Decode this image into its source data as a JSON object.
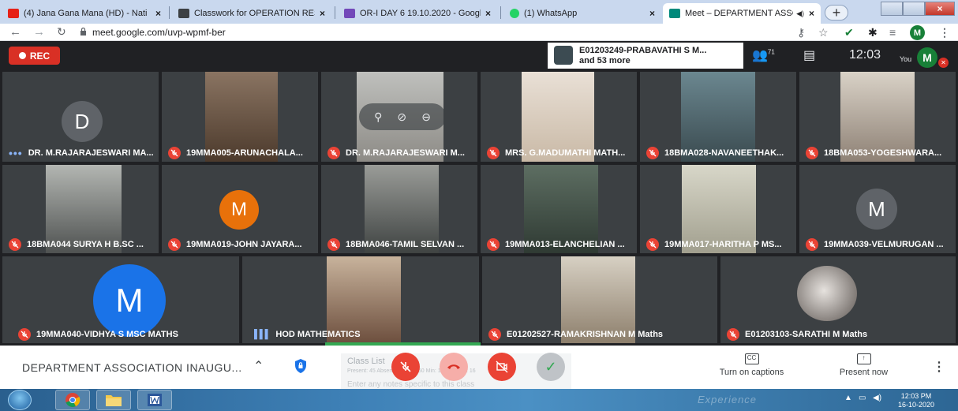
{
  "browser": {
    "tabs": [
      {
        "title": "(4) Jana Gana Mana (HD) - Nati",
        "favicon_color": "#e62117",
        "icon": "youtube-icon"
      },
      {
        "title": "Classwork for OPERATION RESE",
        "favicon_color": "#3c4043",
        "icon": "classroom-icon"
      },
      {
        "title": "OR-I DAY 6 19.10.2020 - Googl",
        "favicon_color": "#7248b9",
        "icon": "forms-icon"
      },
      {
        "title": "(1) WhatsApp",
        "favicon_color": "#25d366",
        "icon": "whatsapp-icon"
      },
      {
        "title": "Meet – DEPARTMENT ASSC",
        "favicon_color": "#00897b",
        "icon": "meet-icon",
        "active": true
      }
    ],
    "new_tab": "+",
    "close_glyph": "×",
    "url": "meet.google.com/uvp-wpmf-ber",
    "profile_initial": "M"
  },
  "meet_top": {
    "rec_label": "REC",
    "presenter_line1": "E01203249-PRABAVATHI S M...",
    "presenter_line2": "and 53 more",
    "participants_count": "71",
    "time": "12:03",
    "you_label": "You",
    "you_initial": "M"
  },
  "participants": [
    {
      "name": "DR. M.RAJARAJESWARI MA...",
      "type": "avatar",
      "initial": "D",
      "avatar_color": "#5f6368",
      "mic": "dots"
    },
    {
      "name": "19MMA005-ARUNACHALA...",
      "type": "video",
      "mic": "off"
    },
    {
      "name": "DR. M.RAJARAJESWARI M...",
      "type": "video",
      "mic": "off"
    },
    {
      "name": "MRS. G.MADUMATHI MATH...",
      "type": "video",
      "mic": "off"
    },
    {
      "name": "18BMA028-NAVANEETHAK...",
      "type": "video",
      "mic": "off"
    },
    {
      "name": "18BMA053-YOGESHWARA...",
      "type": "video",
      "mic": "off"
    },
    {
      "name": "18BMA044 SURYA H B.SC ...",
      "type": "video",
      "mic": "off"
    },
    {
      "name": "19MMA019-JOHN JAYARA...",
      "type": "avatar",
      "initial": "M",
      "avatar_color": "#e8710a",
      "mic": "off"
    },
    {
      "name": "18BMA046-TAMIL SELVAN ...",
      "type": "video",
      "mic": "off"
    },
    {
      "name": "19MMA013-ELANCHELIAN ...",
      "type": "video",
      "mic": "off"
    },
    {
      "name": "19MMA017-HARITHA P MS...",
      "type": "video",
      "mic": "off"
    },
    {
      "name": "19MMA039-VELMURUGAN ...",
      "type": "avatar",
      "initial": "M",
      "avatar_color": "#5f6368",
      "mic": "off"
    },
    {
      "name": "19MMA040-VIDHYA S MSC MATHS",
      "type": "avatar",
      "initial": "M",
      "avatar_color": "#1a73e8",
      "mic": "off"
    },
    {
      "name": "HOD MATHEMATICS",
      "type": "video",
      "mic": "speaking"
    },
    {
      "name": "E01202527-RAMAKRISHNAN M Maths",
      "type": "video",
      "mic": "off"
    },
    {
      "name": "E01203103-SARATHI M Maths",
      "type": "video",
      "mic": "off"
    }
  ],
  "bottom": {
    "meeting_title": "DEPARTMENT ASSOCIATION INAUGU...",
    "overlay_title": "Class List",
    "overlay_stats": "Present: 45   Absent: 53   Max: 60   Min: 14   Duration: 16",
    "overlay_placeholder": "Enter any notes specific to this class",
    "captions_label": "Turn on captions",
    "captions_icon_text": "CC",
    "present_label": "Present now"
  },
  "taskbar": {
    "time": "12:03 PM",
    "date": "16-10-2020",
    "watermark": "Experience"
  }
}
